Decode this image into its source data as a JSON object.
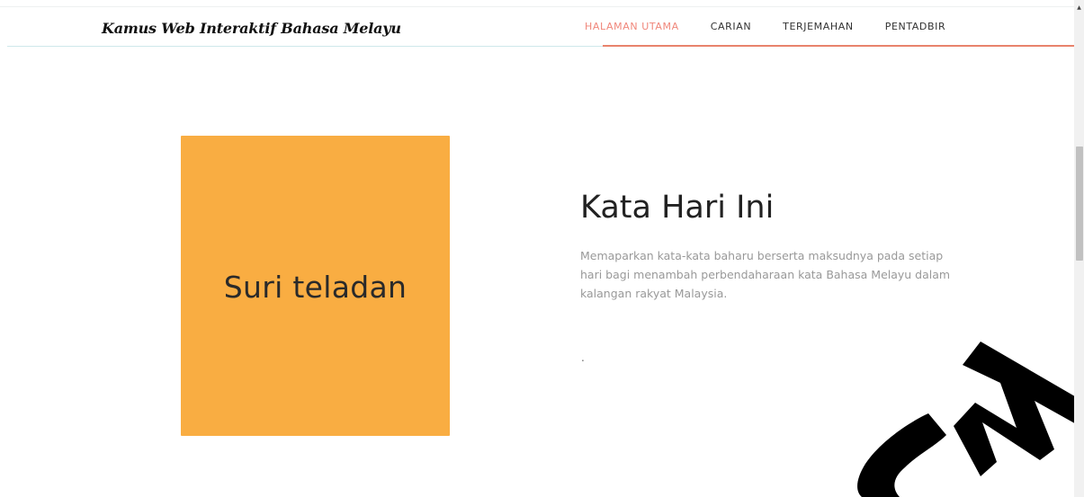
{
  "header": {
    "brand": "Kamus Web Interaktif Bahasa Melayu",
    "nav": [
      {
        "label": "HALAMAN UTAMA",
        "active": true
      },
      {
        "label": "CARIAN",
        "active": false
      },
      {
        "label": "TERJEMAHAN",
        "active": false
      },
      {
        "label": "PENTADBIR",
        "active": false
      }
    ]
  },
  "main": {
    "word_of_day": "Suri teladan",
    "heading": "Kata Hari Ini",
    "description": "Memaparkan kata-kata baharu berserta maksudnya pada setiap hari bagi menambah perbendaharaan kata Bahasa Melayu dalam kalangan rakyat Malaysia.",
    "meaning": "."
  },
  "watermark": {
    "text": "SM"
  },
  "colors": {
    "accent": "#f0867a",
    "card": "#f9ad42",
    "watermark": "#000000"
  }
}
